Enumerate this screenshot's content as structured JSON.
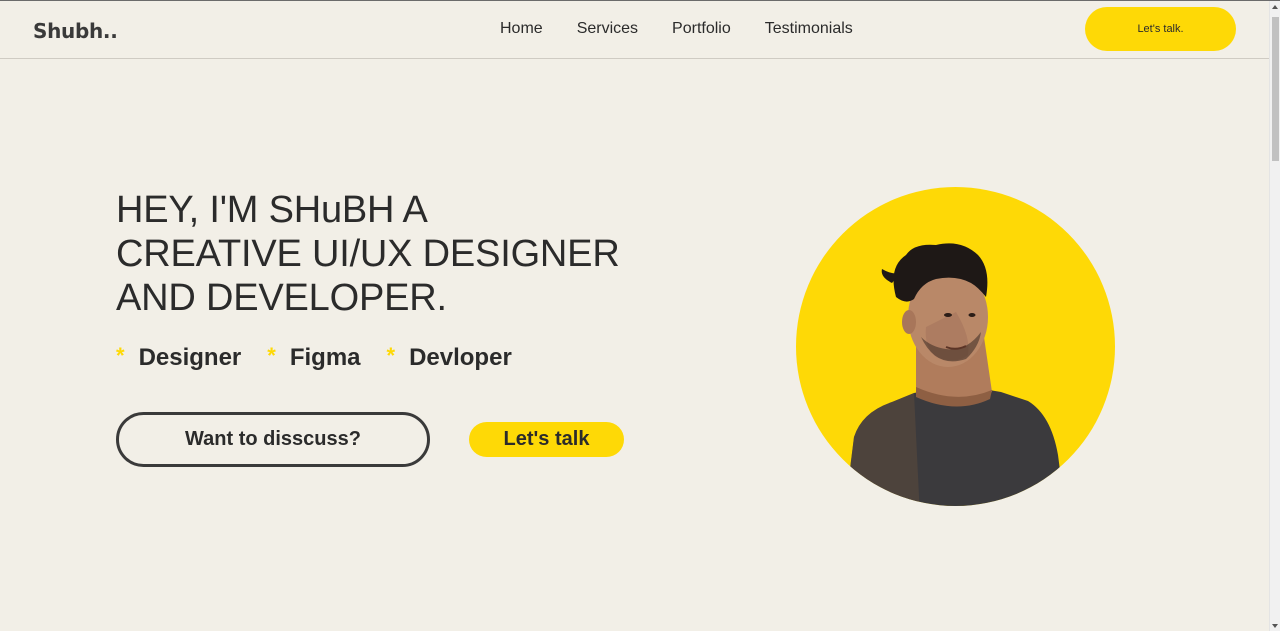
{
  "header": {
    "logo": "Shubh..",
    "nav": [
      "Home",
      "Services",
      "Portfolio",
      "Testimonials"
    ],
    "cta_label": "Let's talk."
  },
  "hero": {
    "title_lines": [
      "HEY, I'M SHuBH A",
      "CREATIVE UI/UX DESIGNER",
      "AND DEVELOPER."
    ],
    "skills": [
      "Designer",
      "Figma",
      "Devloper"
    ],
    "skill_marker": "*",
    "primary_button": "Want to disscuss?",
    "secondary_button": "Let's talk"
  },
  "colors": {
    "accent": "#fed906",
    "background": "#f2efe7",
    "text": "#2b2b2b"
  },
  "icons": {
    "skill_marker": "asterisk-icon"
  }
}
